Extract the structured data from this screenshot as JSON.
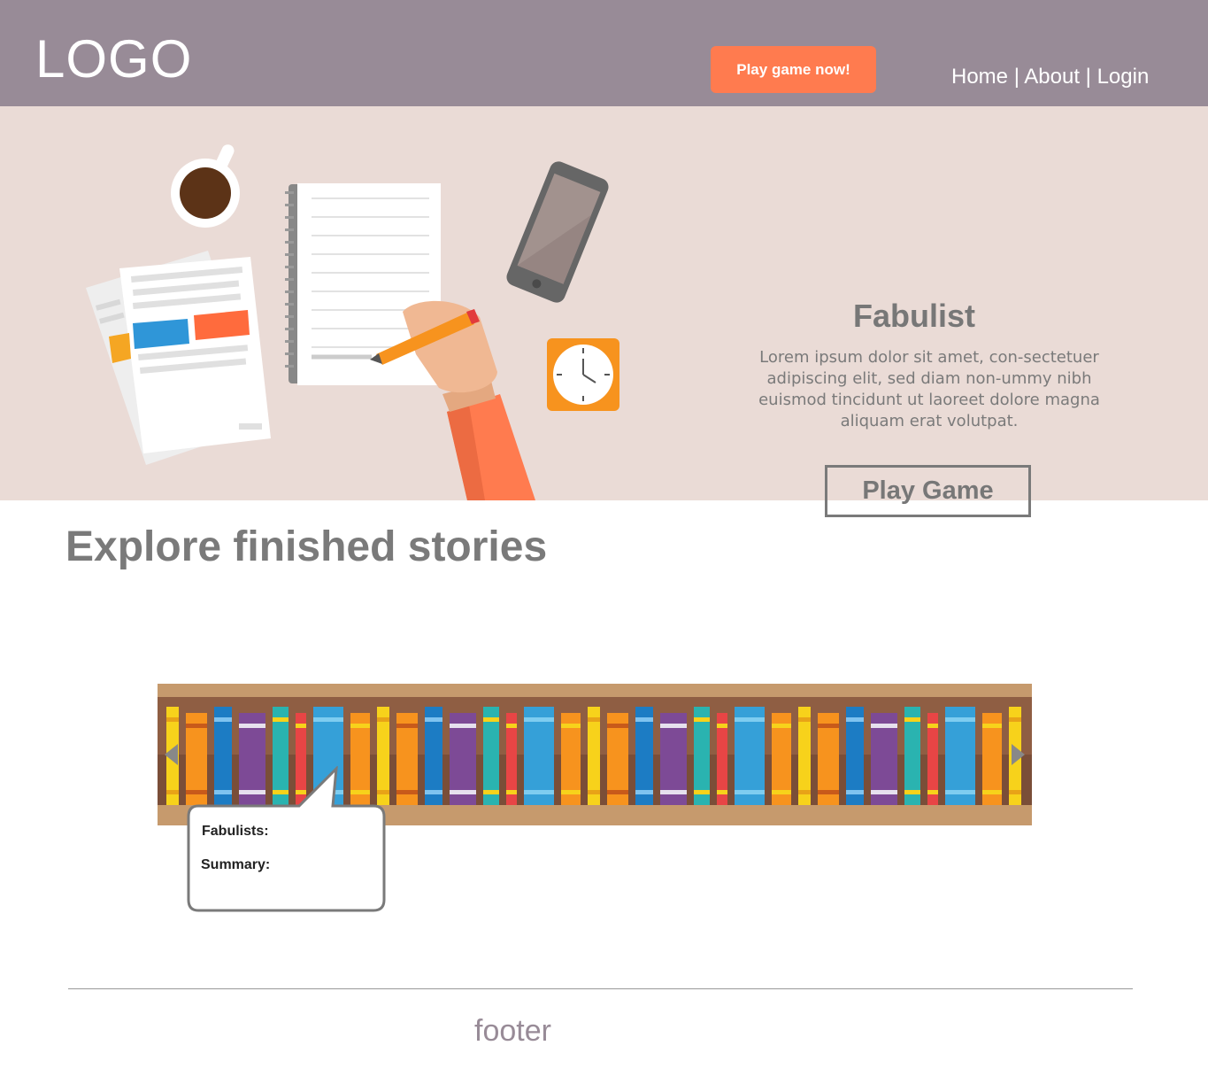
{
  "header": {
    "logo": "LOGO",
    "cta_label": "Play game now!",
    "nav": [
      "Home",
      "About",
      "Login"
    ],
    "nav_separator": "|"
  },
  "hero": {
    "title": "Fabulist",
    "description": "Lorem ipsum dolor sit amet, con-sectetuer adipiscing elit, sed diam non-ummy nibh euismod tincidunt ut laoreet dolore magna aliquam erat volutpat.",
    "play_label": "Play Game",
    "icons": [
      "coffee-cup-icon",
      "documents-icon",
      "notebook-icon",
      "hand-pencil-icon",
      "smartphone-icon",
      "clock-icon"
    ]
  },
  "explore": {
    "heading": "Explore finished stories",
    "bubble": {
      "fabulists_label": "Fabulists:",
      "summary_label": "Summary:"
    }
  },
  "footer": {
    "text": "footer"
  },
  "colors": {
    "header_bg": "#988b97",
    "hero_bg": "#eadbd6",
    "accent": "#ff7b4f",
    "text_gray": "#7a7a7a"
  }
}
